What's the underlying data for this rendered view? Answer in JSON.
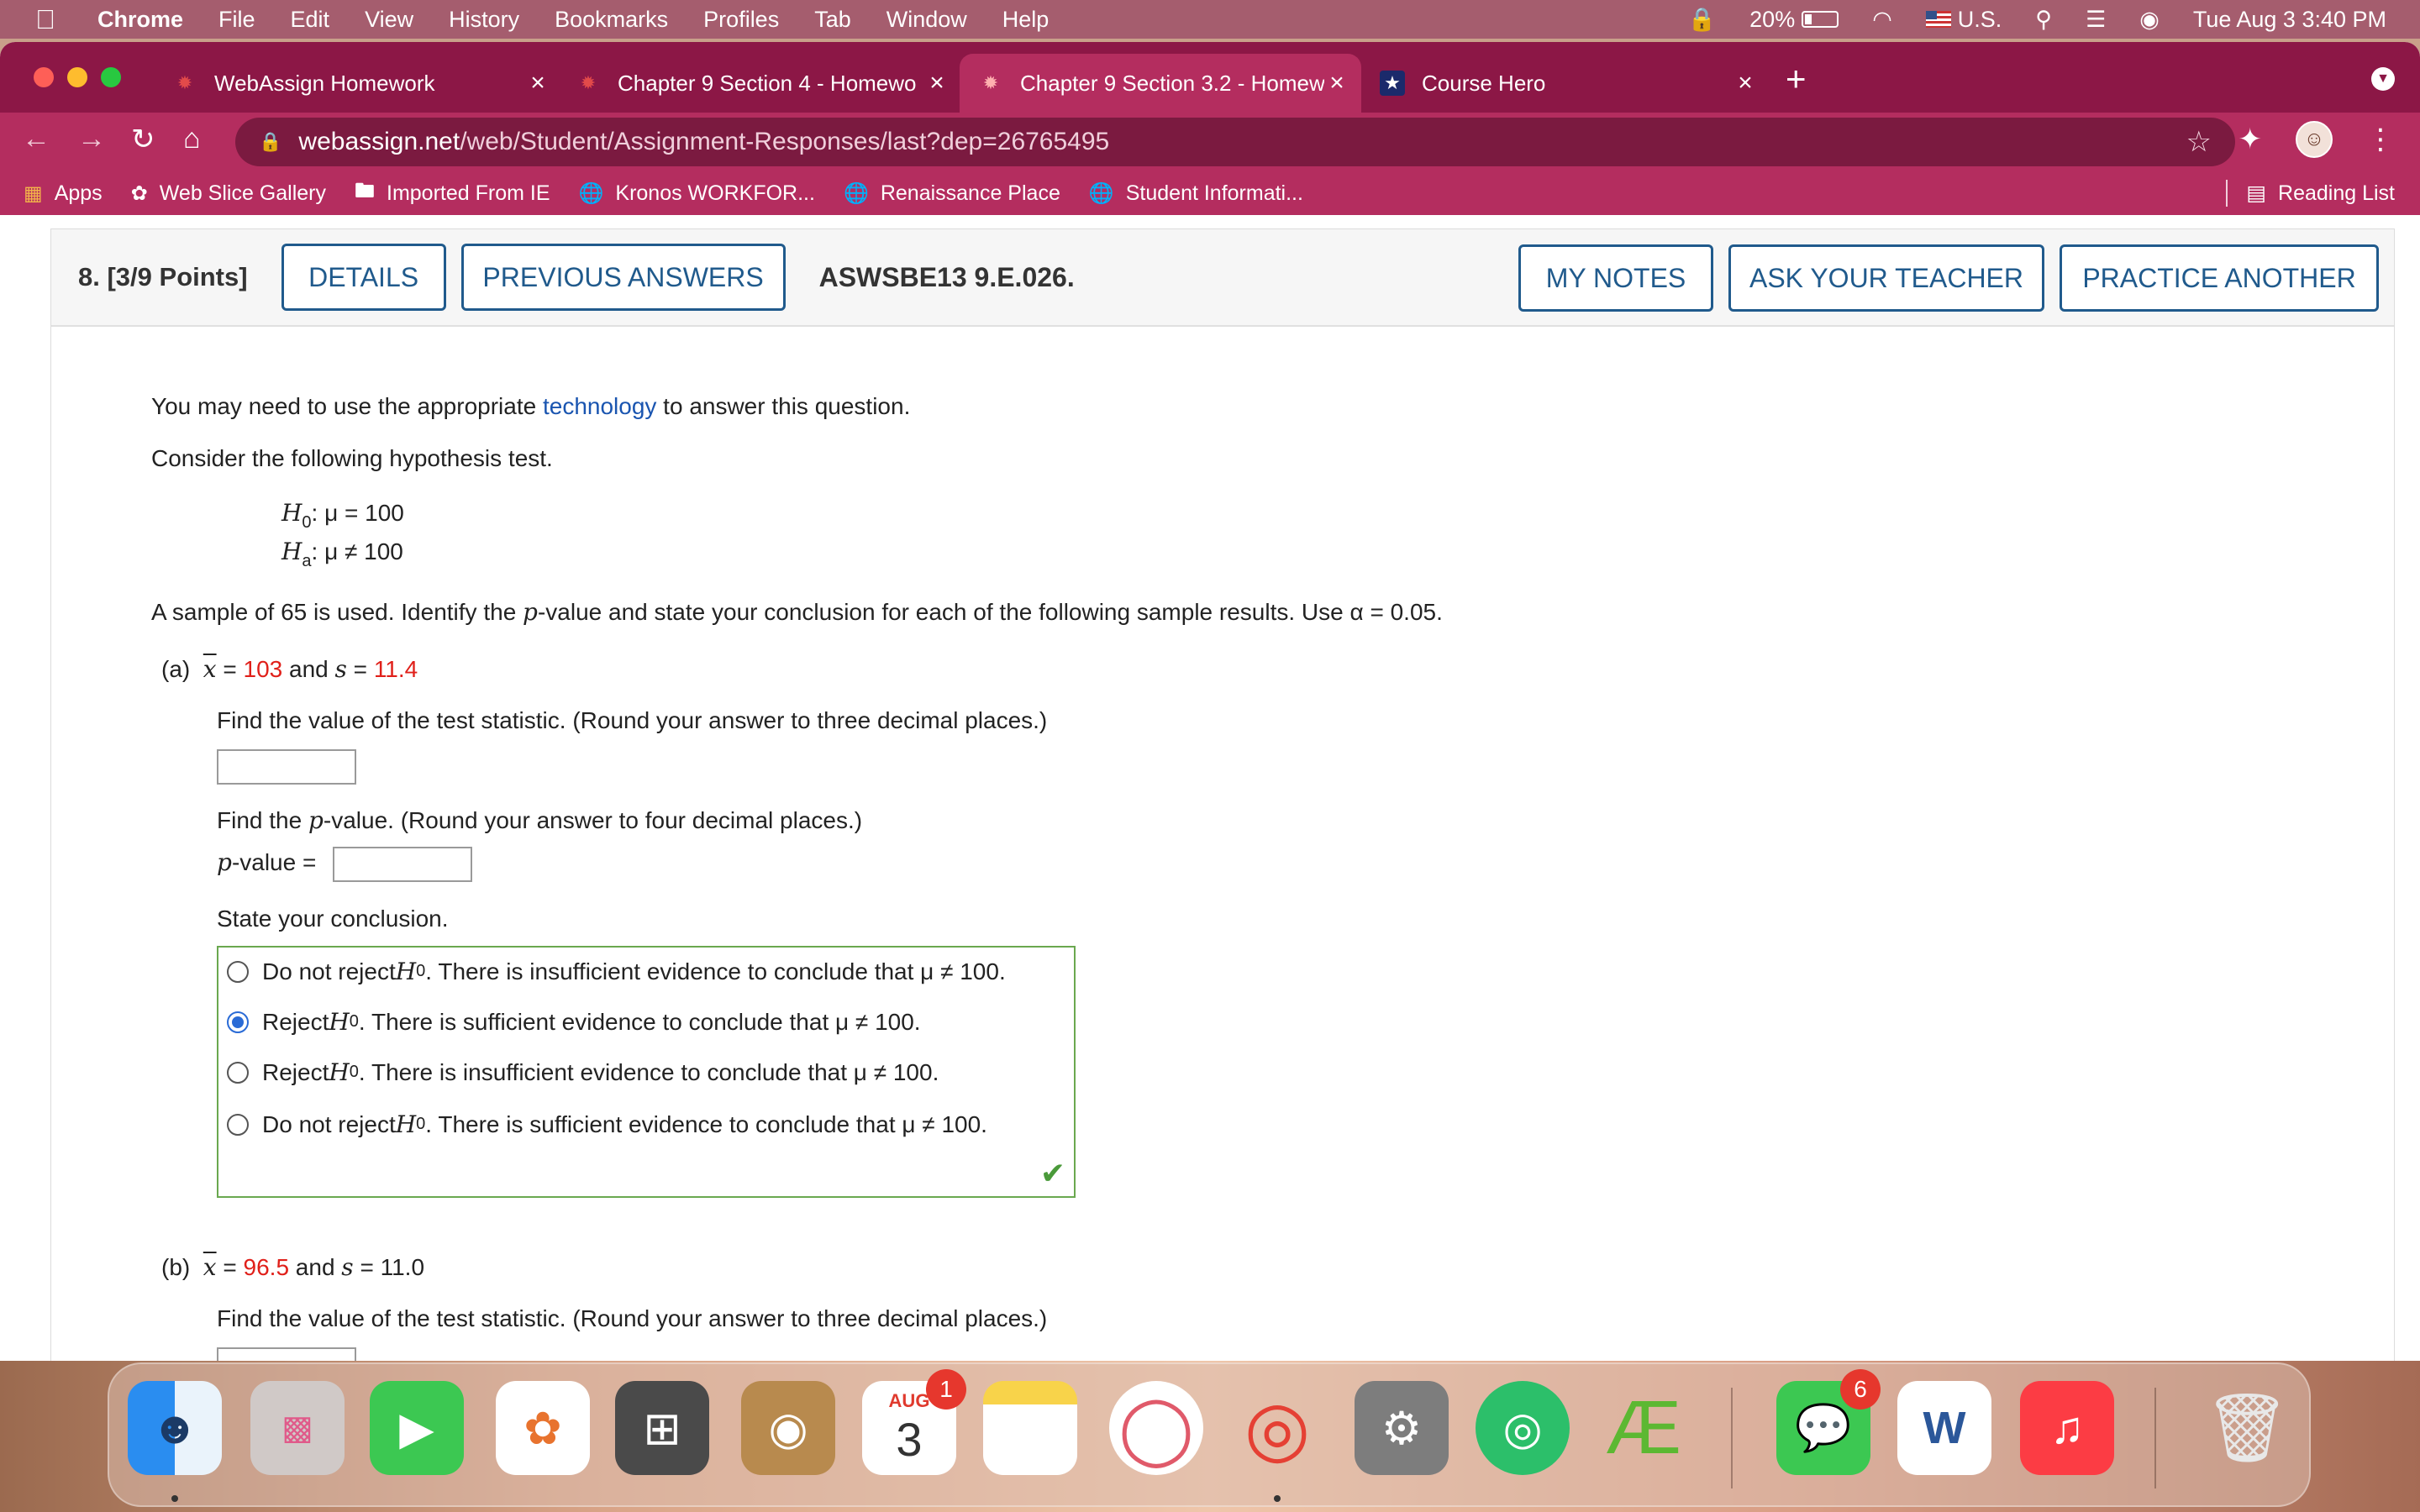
{
  "menubar": {
    "app": "Chrome",
    "items": [
      "File",
      "Edit",
      "View",
      "History",
      "Bookmarks",
      "Profiles",
      "Tab",
      "Window",
      "Help"
    ],
    "battery": "20%",
    "input_source": "U.S.",
    "datetime": "Tue Aug 3  3:40 PM"
  },
  "tabs": [
    {
      "title": "WebAssign Homework",
      "icon": "webassign-icon"
    },
    {
      "title": "Chapter 9 Section 4 - Homewo",
      "icon": "webassign-icon"
    },
    {
      "title": "Chapter 9 Section 3.2 - Homew",
      "icon": "webassign-icon"
    },
    {
      "title": "Course Hero",
      "icon": "star-icon"
    }
  ],
  "address": {
    "host": "webassign.net",
    "path": "/web/Student/Assignment-Responses/last?dep=26765495"
  },
  "bookmarks": {
    "items": [
      "Apps",
      "Web Slice Gallery",
      "Imported From IE",
      "Kronos WORKFOR...",
      "Renaissance Place",
      "Student Informati..."
    ],
    "reading_list": "Reading List"
  },
  "question": {
    "number": "8.",
    "points": "[3/9 Points]",
    "details_btn": "DETAILS",
    "prev_btn": "PREVIOUS ANSWERS",
    "code": "ASWSBE13 9.E.026.",
    "notes_btn": "MY NOTES",
    "ask_btn": "ASK YOUR TEACHER",
    "practice_btn": "PRACTICE ANOTHER",
    "intro_pre": "You may need to use the appropriate ",
    "intro_link": "technology",
    "intro_post": " to answer this question.",
    "consider": "Consider the following hypothesis test.",
    "h0_rest": ": μ = 100",
    "ha_rest": ": μ ≠ 100",
    "sample_pre": "A sample of 65 is used. Identify the ",
    "sample_mid": "-value and state your conclusion for each of the following sample results. Use ",
    "sample_alpha": "α = 0.05.",
    "a_label": "(a)",
    "a_xbar": "103",
    "a_s": "11.4",
    "b_label": "(b)",
    "b_xbar": "96.5",
    "b_s": "11.0",
    "find_test": "Find the value of the test statistic. (Round your answer to three decimal places.)",
    "find_p_pre": "Find the ",
    "find_p_post": "-value. (Round your answer to four decimal places.)",
    "pvalue_label": "-value =",
    "state": "State your conclusion.",
    "choices": [
      {
        "pre": "Do not reject ",
        "post": ". There is insufficient evidence to conclude that μ ≠ 100.",
        "selected": false
      },
      {
        "pre": "Reject ",
        "post": ". There is sufficient evidence to conclude that μ ≠ 100.",
        "selected": true
      },
      {
        "pre": "Reject ",
        "post": ". There is insufficient evidence to conclude that μ ≠ 100.",
        "selected": false
      },
      {
        "pre": "Do not reject ",
        "post": ". There is sufficient evidence to conclude that μ ≠ 100.",
        "selected": false
      }
    ]
  },
  "dock": {
    "calendar_month": "AUG",
    "calendar_day": "3",
    "calendar_badge": "1",
    "messages_badge": "6"
  }
}
